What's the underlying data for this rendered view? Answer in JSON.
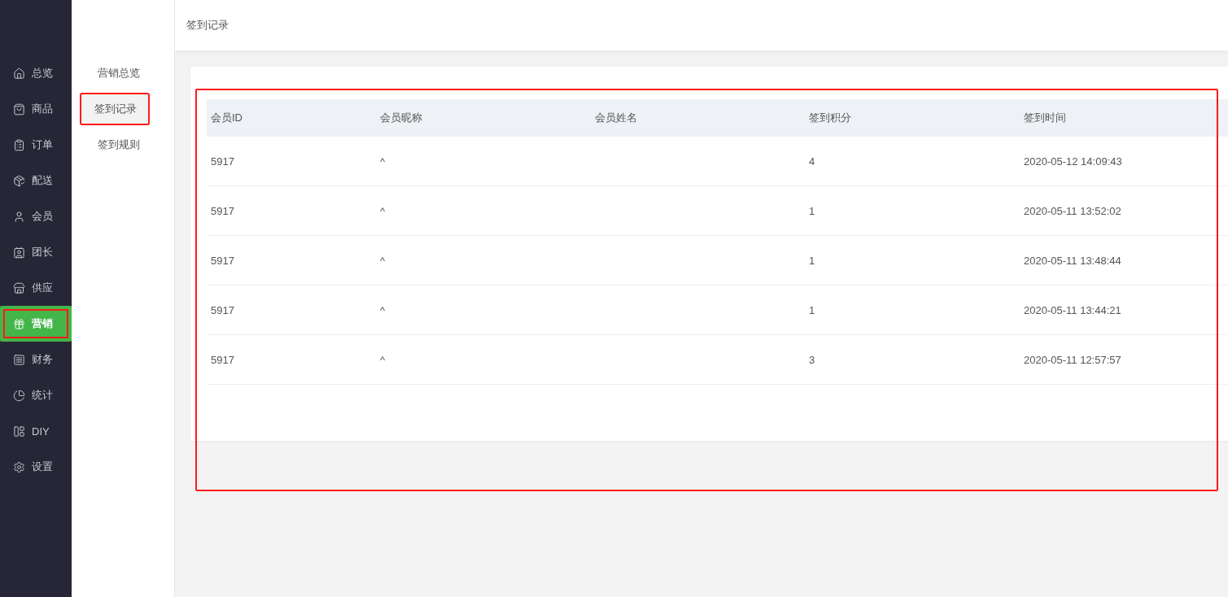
{
  "nav": [
    {
      "label": "总览",
      "selected": false,
      "highlighted": false
    },
    {
      "label": "商品",
      "selected": false,
      "highlighted": false
    },
    {
      "label": "订单",
      "selected": false,
      "highlighted": false
    },
    {
      "label": "配送",
      "selected": false,
      "highlighted": false
    },
    {
      "label": "会员",
      "selected": false,
      "highlighted": false
    },
    {
      "label": "团长",
      "selected": false,
      "highlighted": false
    },
    {
      "label": "供应",
      "selected": false,
      "highlighted": false
    },
    {
      "label": "营销",
      "selected": true,
      "highlighted": true
    },
    {
      "label": "财务",
      "selected": false,
      "highlighted": false
    },
    {
      "label": "统计",
      "selected": false,
      "highlighted": false
    },
    {
      "label": "DIY",
      "selected": false,
      "highlighted": false
    },
    {
      "label": "设置",
      "selected": false,
      "highlighted": false
    }
  ],
  "subnav": [
    {
      "label": "营销总览",
      "selected": false,
      "highlighted": false
    },
    {
      "label": "签到记录",
      "selected": true,
      "highlighted": true
    },
    {
      "label": "签到规则",
      "selected": false,
      "highlighted": false
    }
  ],
  "header": {
    "title": "签到记录"
  },
  "table": {
    "highlighted": true,
    "columns": [
      "会员ID",
      "会员昵称",
      "会员姓名",
      "签到积分",
      "签到时间"
    ],
    "rows": [
      [
        "5917",
        "^",
        "",
        "4",
        "2020-05-12 14:09:43"
      ],
      [
        "5917",
        "^",
        "",
        "1",
        "2020-05-11 13:52:02"
      ],
      [
        "5917",
        "^",
        "",
        "1",
        "2020-05-11 13:48:44"
      ],
      [
        "5917",
        "^",
        "",
        "1",
        "2020-05-11 13:44:21"
      ],
      [
        "5917",
        "^",
        "",
        "3",
        "2020-05-11 12:57:57"
      ]
    ]
  }
}
